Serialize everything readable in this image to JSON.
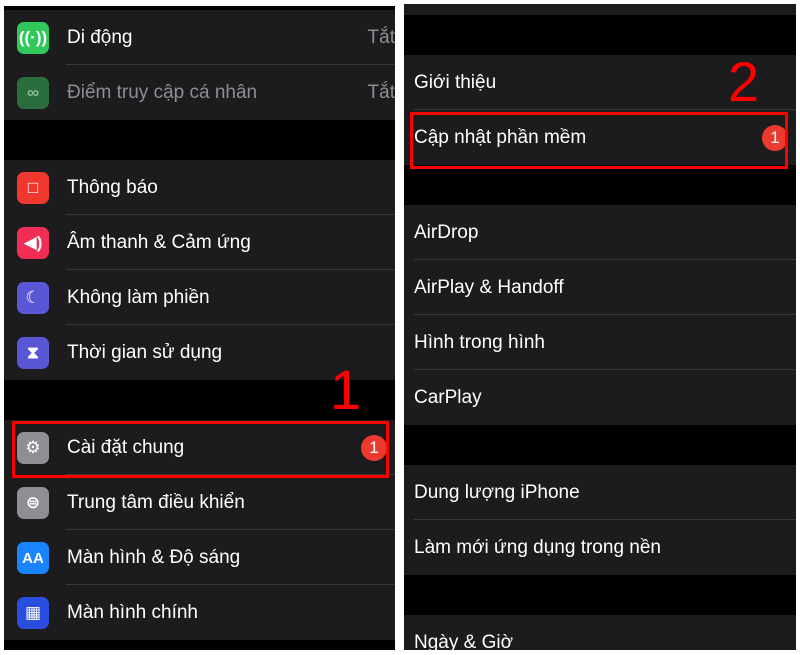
{
  "left": {
    "group1": [
      {
        "label": "Di động",
        "value": "Tắt",
        "icon": "antenna-icon",
        "color": "#30c85a"
      },
      {
        "label": "Điểm truy cập cá nhân",
        "value": "Tắt",
        "icon": "hotspot-icon",
        "color": "#2b6e3e",
        "disabled": true
      }
    ],
    "group2": [
      {
        "label": "Thông báo",
        "icon": "notification-icon",
        "color": "#f0382e"
      },
      {
        "label": "Âm thanh & Cảm ứng",
        "icon": "speaker-icon",
        "color": "#f02d55"
      },
      {
        "label": "Không làm phiền",
        "icon": "moon-icon",
        "color": "#5a57d6"
      },
      {
        "label": "Thời gian sử dụng",
        "icon": "hourglass-icon",
        "color": "#5a57d6"
      }
    ],
    "group3": [
      {
        "label": "Cài đặt chung",
        "icon": "gear-icon",
        "color": "#8e8e93",
        "badge": "1"
      },
      {
        "label": "Trung tâm điều khiển",
        "icon": "toggles-icon",
        "color": "#8e8e93"
      },
      {
        "label": "Màn hình & Độ sáng",
        "icon": "text-size-icon",
        "color": "#1a84ff",
        "glyph": "AA"
      },
      {
        "label": "Màn hình chính",
        "icon": "home-grid-icon",
        "color": "#2a4fe0"
      }
    ],
    "step": "1"
  },
  "right": {
    "group1": [
      {
        "label": "Giới thiệu"
      },
      {
        "label": "Cập nhật phần mềm",
        "badge": "1"
      }
    ],
    "group2": [
      {
        "label": "AirDrop"
      },
      {
        "label": "AirPlay & Handoff"
      },
      {
        "label": "Hình trong hình"
      },
      {
        "label": "CarPlay"
      }
    ],
    "group3": [
      {
        "label": "Dung lượng iPhone"
      },
      {
        "label": "Làm mới ứng dụng trong nền"
      }
    ],
    "group4": [
      {
        "label": "Ngày & Giờ"
      }
    ],
    "step": "2"
  },
  "colors": {
    "highlight": "#ff0000",
    "badge": "#eb3b30",
    "cell": "#1c1c1e"
  }
}
